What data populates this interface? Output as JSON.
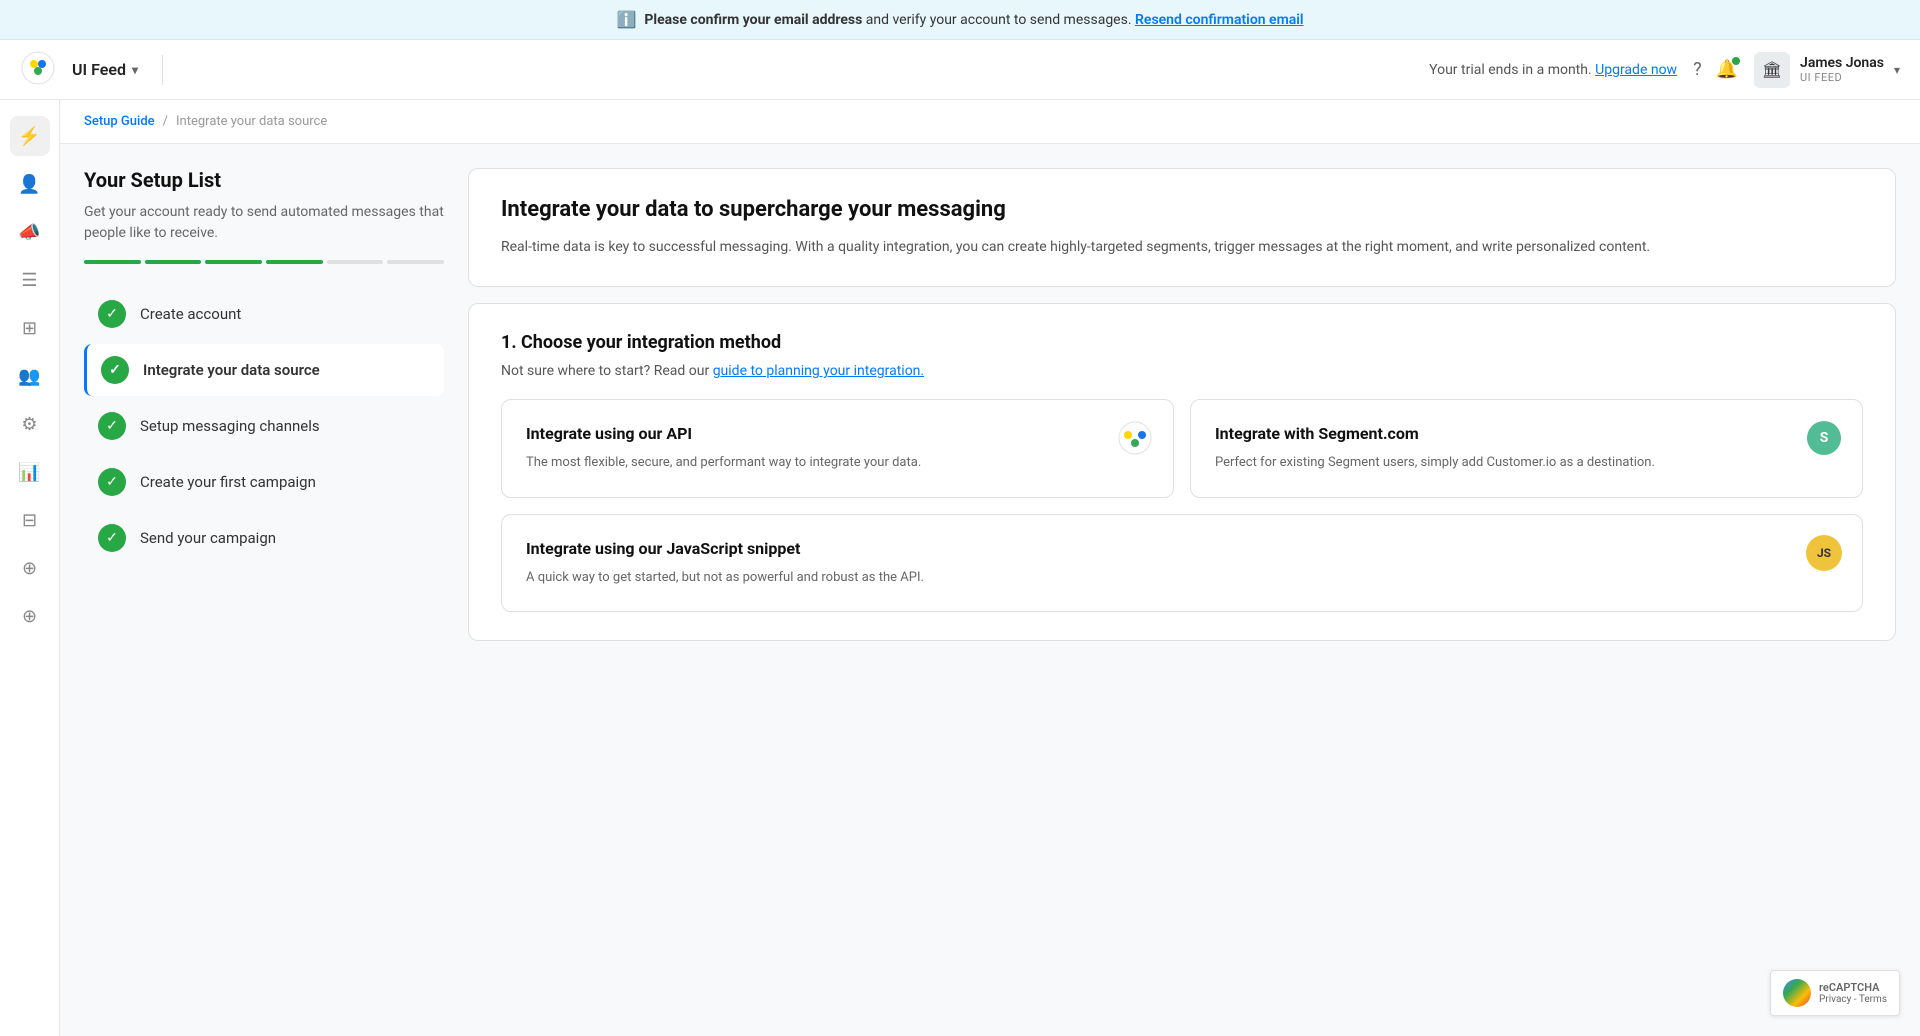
{
  "notif_bar": {
    "icon": "?",
    "text_bold": "Please confirm your email address",
    "text_normal": " and verify your account to send messages.",
    "link_text": "Resend confirmation email"
  },
  "header": {
    "brand_name": "UI Feed",
    "trial_text": "Your trial ends in a month.",
    "upgrade_link": "Upgrade now",
    "user_name": "James Jonas",
    "user_org": "UI FEED"
  },
  "breadcrumb": {
    "parent": "Setup Guide",
    "current": "Integrate your data source"
  },
  "sidebar_icons": [
    {
      "name": "data-source-icon",
      "glyph": "⚡",
      "active": true
    },
    {
      "name": "people-icon",
      "glyph": "👤"
    },
    {
      "name": "megaphone-icon",
      "glyph": "📣"
    },
    {
      "name": "list-icon",
      "glyph": "☰"
    },
    {
      "name": "grid-icon",
      "glyph": "⊞"
    },
    {
      "name": "users-icon",
      "glyph": "👥"
    },
    {
      "name": "settings-icon",
      "glyph": "⚙"
    },
    {
      "name": "chart-icon",
      "glyph": "📊"
    },
    {
      "name": "filter-icon",
      "glyph": "⊟"
    },
    {
      "name": "import-icon",
      "glyph": "⊕"
    },
    {
      "name": "export-icon",
      "glyph": "⊕"
    }
  ],
  "setup_list": {
    "title": "Your Setup List",
    "subtitle": "Get your account ready to send automated messages that people like to receive.",
    "progress_segments": [
      {
        "filled": true
      },
      {
        "filled": true
      },
      {
        "filled": true
      },
      {
        "filled": true
      },
      {
        "filled": false
      },
      {
        "filled": false
      }
    ],
    "items": [
      {
        "label": "Create account",
        "checked": true,
        "active": false
      },
      {
        "label": "Integrate your data source",
        "checked": true,
        "active": true
      },
      {
        "label": "Setup messaging channels",
        "checked": true,
        "active": false
      },
      {
        "label": "Create your first campaign",
        "checked": true,
        "active": false
      },
      {
        "label": "Send your campaign",
        "checked": true,
        "active": false
      }
    ]
  },
  "detail": {
    "hero_title": "Integrate your data to supercharge your messaging",
    "hero_desc": "Real-time data is key to successful messaging. With a quality integration, you can create highly-targeted segments, trigger messages at the right moment, and write personalized content.",
    "section_title": "1. Choose your integration method",
    "section_subtitle_pre": "Not sure where to start? Read our ",
    "section_subtitle_link": "guide to planning your integration.",
    "integration_cards": [
      {
        "title": "Integrate using our API",
        "desc": "The most flexible, secure, and performant way to integrate your data.",
        "icon_type": "api"
      },
      {
        "title": "Integrate with Segment.com",
        "desc": "Perfect for existing Segment users, simply add Customer.io as a destination.",
        "icon_type": "segment"
      },
      {
        "title": "Integrate using our JavaScript snippet",
        "desc": "A quick way to get started, but not as powerful and robust as the API.",
        "icon_type": "js"
      }
    ]
  },
  "recaptcha": {
    "label": "reCAPTCHA",
    "subtext": "Privacy - Terms"
  }
}
